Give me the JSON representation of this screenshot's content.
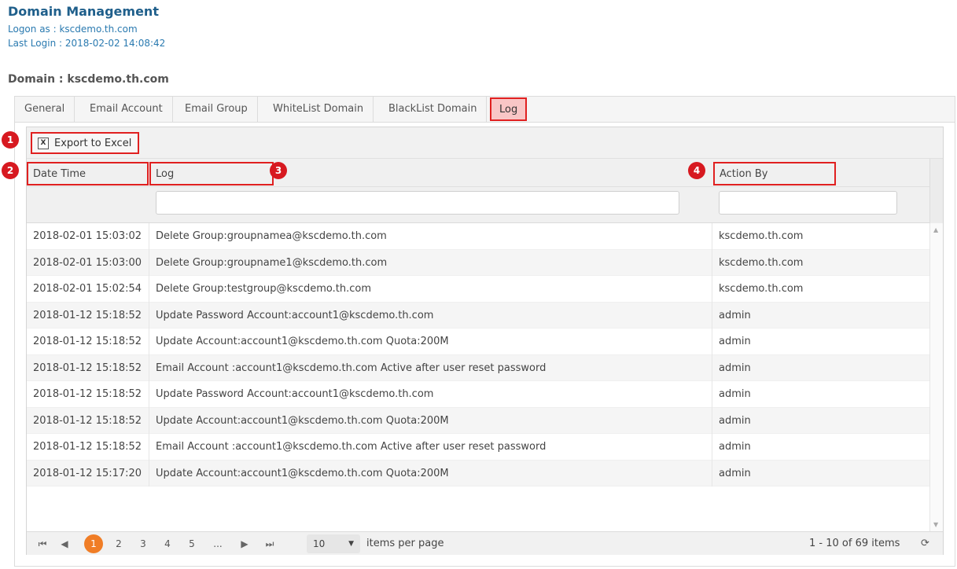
{
  "header": {
    "title": "Domain Management",
    "logon": "Logon as : kscdemo.th.com",
    "last_login": "Last Login : 2018-02-02 14:08:42"
  },
  "domain_title": "Domain : kscdemo.th.com",
  "tabs": [
    {
      "label": "General"
    },
    {
      "label": "Email Account"
    },
    {
      "label": "Email Group"
    },
    {
      "label": "WhiteList Domain"
    },
    {
      "label": "BlackList Domain"
    },
    {
      "label": "Log",
      "active": true
    }
  ],
  "toolbar": {
    "export_label": "Export to Excel",
    "export_icon": "excel-icon"
  },
  "columns": [
    "Date Time",
    "Log",
    "Action By"
  ],
  "rows": [
    {
      "date": "2018-02-01 15:03:02",
      "log": "Delete Group:groupnamea@kscdemo.th.com",
      "by": "kscdemo.th.com"
    },
    {
      "date": "2018-02-01 15:03:00",
      "log": "Delete Group:groupname1@kscdemo.th.com",
      "by": "kscdemo.th.com"
    },
    {
      "date": "2018-02-01 15:02:54",
      "log": "Delete Group:testgroup@kscdemo.th.com",
      "by": "kscdemo.th.com"
    },
    {
      "date": "2018-01-12 15:18:52",
      "log": "Update Password Account:account1@kscdemo.th.com",
      "by": "admin"
    },
    {
      "date": "2018-01-12 15:18:52",
      "log": "Update Account:account1@kscdemo.th.com Quota:200M",
      "by": "admin"
    },
    {
      "date": "2018-01-12 15:18:52",
      "log": "Email Account :account1@kscdemo.th.com Active after user reset password",
      "by": "admin"
    },
    {
      "date": "2018-01-12 15:18:52",
      "log": "Update Password Account:account1@kscdemo.th.com",
      "by": "admin"
    },
    {
      "date": "2018-01-12 15:18:52",
      "log": "Update Account:account1@kscdemo.th.com Quota:200M",
      "by": "admin"
    },
    {
      "date": "2018-01-12 15:18:52",
      "log": "Email Account :account1@kscdemo.th.com Active after user reset password",
      "by": "admin"
    },
    {
      "date": "2018-01-12 15:17:20",
      "log": "Update Account:account1@kscdemo.th.com Quota:200M",
      "by": "admin"
    }
  ],
  "pager": {
    "pages": [
      "1",
      "2",
      "3",
      "4",
      "5",
      "..."
    ],
    "current": "1",
    "page_size": "10",
    "items_per_page": "items per page",
    "info": "1 - 10 of 69 items"
  },
  "markers": [
    "1",
    "2",
    "3",
    "4"
  ],
  "colors": {
    "accent": "#f07d26",
    "highlight": "#e02020",
    "marker": "#d71920",
    "title": "#1f5f8b"
  }
}
